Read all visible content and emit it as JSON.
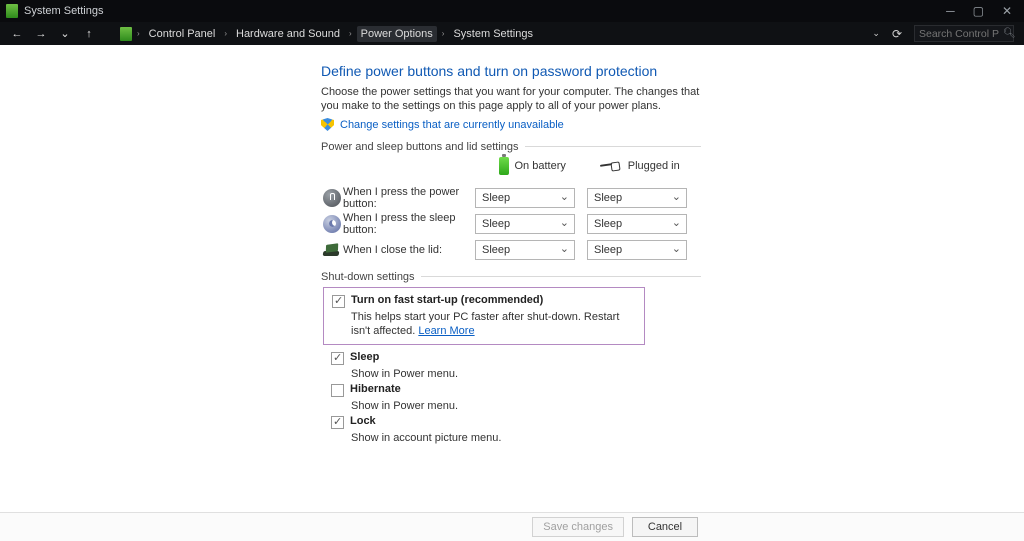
{
  "titlebar": {
    "title": "System Settings"
  },
  "nav": {
    "crumbs": [
      "Control Panel",
      "Hardware and Sound",
      "Power Options",
      "System Settings"
    ],
    "active_index": 2,
    "search_placeholder": "Search Control Panel"
  },
  "page": {
    "heading": "Define power buttons and turn on password protection",
    "description": "Choose the power settings that you want for your computer. The changes that you make to the settings on this page apply to all of your power plans.",
    "admin_link": "Change settings that are currently unavailable",
    "section_buttons": "Power and sleep buttons and lid settings",
    "col_battery": "On battery",
    "col_plugged": "Plugged in",
    "rows": [
      {
        "label": "When I press the power button:",
        "battery": "Sleep",
        "plugged": "Sleep"
      },
      {
        "label": "When I press the sleep button:",
        "battery": "Sleep",
        "plugged": "Sleep"
      },
      {
        "label": "When I close the lid:",
        "battery": "Sleep",
        "plugged": "Sleep"
      }
    ],
    "section_shutdown": "Shut-down settings",
    "shutdown": {
      "fast_startup": {
        "label": "Turn on fast start-up (recommended)",
        "checked": true,
        "desc_pre": "This helps start your PC faster after shut-down. Restart isn't affected. ",
        "learn_more": "Learn More"
      },
      "sleep": {
        "label": "Sleep",
        "checked": true,
        "desc": "Show in Power menu."
      },
      "hibernate": {
        "label": "Hibernate",
        "checked": false,
        "desc": "Show in Power menu."
      },
      "lock": {
        "label": "Lock",
        "checked": true,
        "desc": "Show in account picture menu."
      }
    }
  },
  "footer": {
    "save": "Save changes",
    "cancel": "Cancel"
  }
}
